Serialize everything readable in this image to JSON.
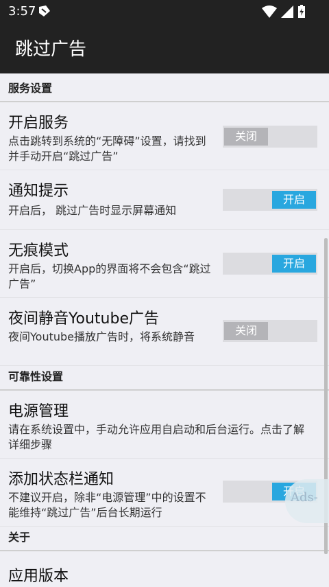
{
  "status_bar": {
    "time": "3:57"
  },
  "toolbar": {
    "title": "跳过广告"
  },
  "sections": {
    "service": "服务设置",
    "reliability": "可靠性设置",
    "about": "关于"
  },
  "prefs": {
    "enable_service": {
      "title": "开启服务",
      "summary": "点击跳转到系统的“无障碍”设置，请找到并手动开启“跳过广告”",
      "toggle": "关闭",
      "state": false
    },
    "notification": {
      "title": "通知提示",
      "summary": "开启后， 跳过广告时显示屏幕通知",
      "toggle": "开启",
      "state": true
    },
    "incognito": {
      "title": "无痕模式",
      "summary": "开启后，切换App的界面将不会包含“跳过广告”",
      "toggle": "开启",
      "state": true
    },
    "night_mute": {
      "title": "夜间静音Youtube广告",
      "summary": "夜间Youtube播放广告时，将系统静音",
      "toggle": "关闭",
      "state": false
    },
    "power": {
      "title": "电源管理",
      "summary": "请在系统设置中，手动允许应用自启动和后台运行。点击了解详细步骤"
    },
    "status_notif": {
      "title": "添加状态栏通知",
      "summary": "不建议开启，除非“电源管理”中的设置不能维持“跳过广告”后台长期运行",
      "toggle": "开启",
      "state": true
    },
    "version": {
      "title": "应用版本"
    }
  },
  "floating_ball": {
    "label": "Ads-"
  },
  "colors": {
    "bar": "#222222",
    "background": "#efeff4",
    "switch_on": "#29a7df",
    "switch_off": "#b4b4b8"
  },
  "icons": [
    "notification-app-icon",
    "wifi-icon",
    "signal-icon",
    "battery-charging-icon"
  ]
}
